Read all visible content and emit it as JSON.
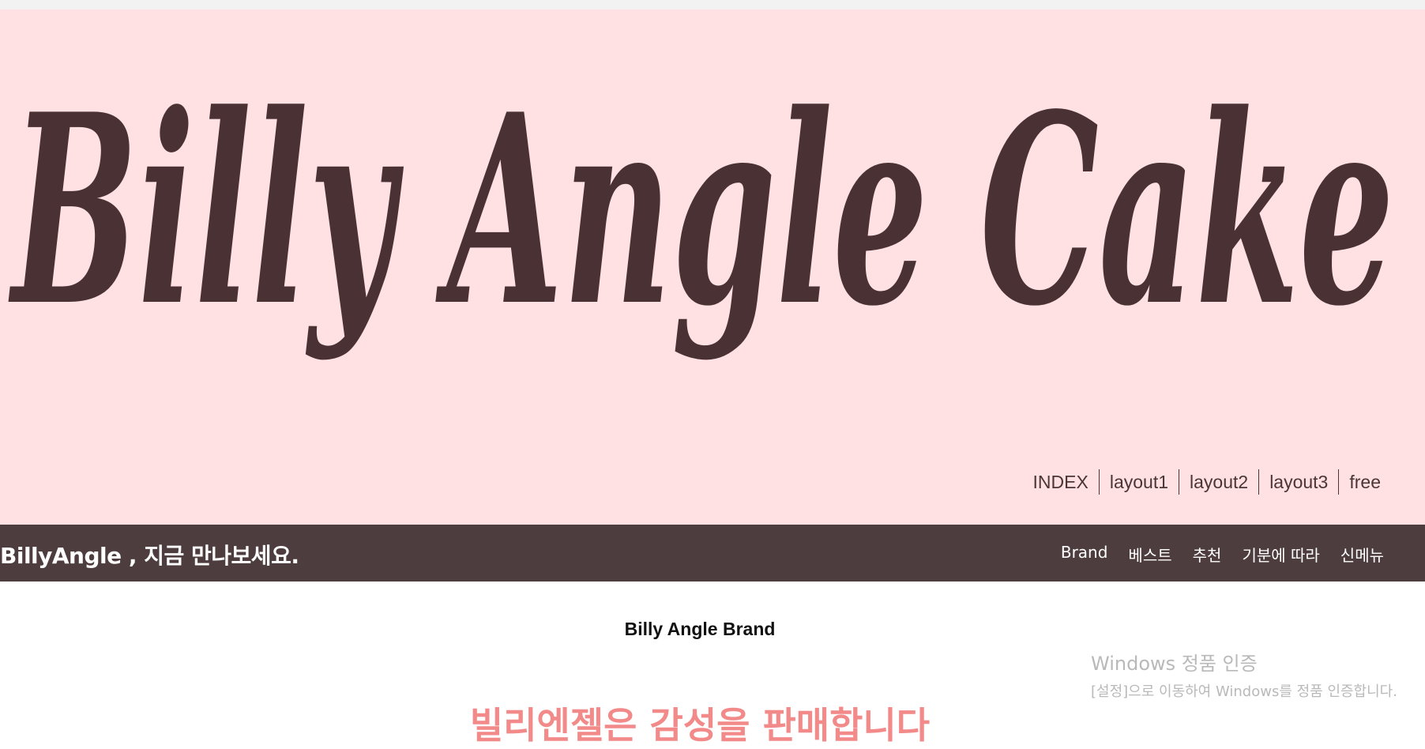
{
  "hero": {
    "logo_text": "Billy Angle Cake",
    "links": [
      "INDEX",
      "layout1",
      "layout2",
      "layout3",
      "free"
    ]
  },
  "navbar": {
    "title": "BillyAngle , 지금 만나보세요.",
    "items": [
      "Brand",
      "베스트",
      "추천",
      "기분에 따라",
      "신메뉴"
    ]
  },
  "content": {
    "section_heading": "Billy Angle Brand",
    "big_heading": "빌리엔젤은 감성을 판매합니다"
  },
  "watermark": {
    "line1": "Windows 정품 인증",
    "line2": "[설정]으로 이동하여 Windows를 정품 인증합니다."
  },
  "colors": {
    "hero_bg": "#ffe1e4",
    "logo": "#4a3234",
    "navbar_bg": "#4e3d3e",
    "accent_pink": "#f28a8a"
  }
}
